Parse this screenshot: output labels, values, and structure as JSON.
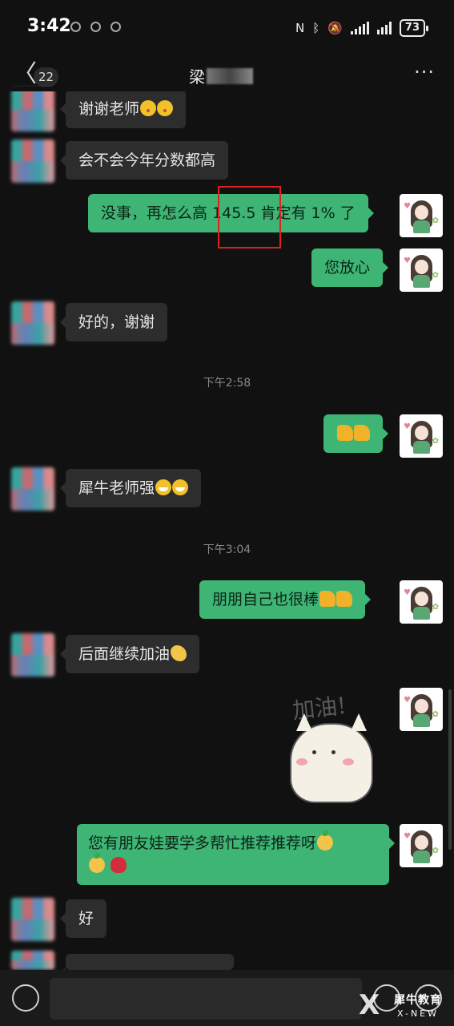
{
  "status": {
    "time": "3:42",
    "battery": "73"
  },
  "nav": {
    "back": "〈",
    "unread": "22",
    "title": "梁",
    "more": "···"
  },
  "messages": {
    "m1": {
      "text": "谢谢老师"
    },
    "m2": {
      "text": "会不会今年分数都高"
    },
    "m3": {
      "text": "没事，再怎么高 145.5 肯定有 1% 了"
    },
    "m4": {
      "text": "您放心"
    },
    "m5": {
      "text": "好的，谢谢"
    },
    "t1": "下午2:58",
    "m6": {
      "text": ""
    },
    "m7": {
      "text": "犀牛老师强"
    },
    "t2": "下午3:04",
    "m8": {
      "text": "朋朋自己也很棒"
    },
    "m9": {
      "text": "后面继续加油"
    },
    "sticker": {
      "text": "加油!"
    },
    "m10": {
      "line1": "您有朋友娃要学多帮忙推荐推荐呀",
      "line2": ""
    },
    "m11": {
      "text": "好"
    }
  },
  "input": {
    "placeholder": ""
  },
  "watermark": {
    "brand": "犀牛教育",
    "sub": "X-NEW"
  },
  "colors": {
    "background": "#111111",
    "sent_bubble": "#3eb575",
    "received_bubble": "#2d2d2d",
    "highlight_box": "#e02020"
  }
}
